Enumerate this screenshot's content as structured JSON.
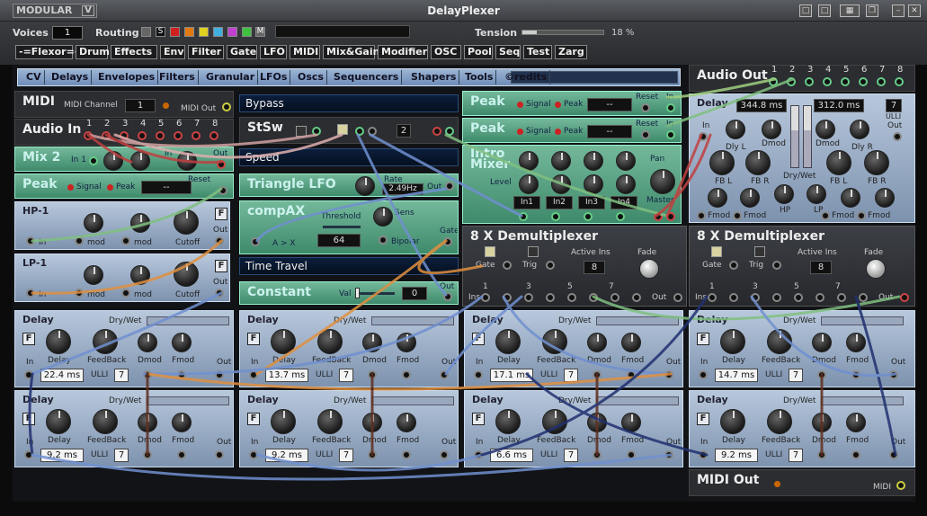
{
  "window": {
    "logo": "MODULAR",
    "logo_badge": "V",
    "title": "DelayPlexer",
    "buttons": [
      "□",
      "□",
      "▦",
      "❐",
      "–",
      "✕"
    ]
  },
  "topbar": {
    "voices_label": "Voices",
    "voices_value": "1",
    "routing_label": "Routing",
    "routing_s": "S",
    "routing_m": "M",
    "routing_colors": [
      "#d02020",
      "#e07a10",
      "#e0d020",
      "#40b0e0",
      "#c040d0",
      "#40c040"
    ],
    "tension_label": "Tension",
    "tension_value": "18 %",
    "tension_level": 0.18
  },
  "categories": [
    "-=Flexor=-",
    "Drum",
    "Effects",
    "Env",
    "Filter",
    "Gate",
    "LFO",
    "MIDI",
    "Mix&Gain",
    "Modifier",
    "OSC",
    "Pool",
    "Seq",
    "Test",
    "Zarg"
  ],
  "cv_tabs": [
    "CV",
    "Delays",
    "Envelopes",
    "Filters",
    "Granular",
    "LFOs",
    "Oscs",
    "Sequencers",
    "Shapers",
    "Tools",
    "©redits"
  ],
  "midi_module": {
    "title": "MIDI",
    "channel_label": "MIDI Channel",
    "channel": "1",
    "out_label": "MIDI Out"
  },
  "audio_in": {
    "title": "Audio In",
    "channels": [
      "1",
      "2",
      "3",
      "4",
      "5",
      "6",
      "7",
      "8"
    ]
  },
  "mix2": {
    "title": "Mix 2",
    "in1": "In 1",
    "in2": "In",
    "out": "Out"
  },
  "peak_left": {
    "title": "Peak",
    "signal": "Signal",
    "peak": "Peak",
    "value": "--",
    "reset": "Reset"
  },
  "hp1": {
    "title": "HP-1",
    "badge": "F",
    "in": "In",
    "mod1": "mod",
    "mod2": "mod",
    "cutoff": "Cutoff",
    "out": "Out"
  },
  "lp1": {
    "title": "LP-1",
    "badge": "F",
    "in": "In",
    "mod1": "mod",
    "mod2": "mod",
    "cutoff": "Cutoff",
    "out": "Out"
  },
  "bypass": {
    "label": "Bypass"
  },
  "stsw": {
    "title": "StSw",
    "value": "2"
  },
  "speed": {
    "label": "Speed"
  },
  "triangle_lfo": {
    "title": "Triangle LFO",
    "rate_label": "Rate",
    "rate": "2.49Hz",
    "out": "Out"
  },
  "compax": {
    "title": "compAX",
    "threshold_label": "Threshold",
    "threshold": "64",
    "sens": "Sens",
    "bipolar": "Bipolar",
    "gate": "Gate",
    "axb": "A > X"
  },
  "time_travel": {
    "label": "Time Travel"
  },
  "constant": {
    "title": "Constant",
    "val_label": "Val",
    "value": "0",
    "level": 0.0,
    "out": "Out"
  },
  "peak_a": {
    "title": "Peak",
    "signal": "Signal",
    "peak": "Peak",
    "value": "--",
    "reset": "Reset",
    "in": "In"
  },
  "peak_b": {
    "title": "Peak",
    "signal": "Signal",
    "peak": "Peak",
    "value": "--",
    "reset": "Reset",
    "in": "In"
  },
  "intro_mixer": {
    "title": "Intro Mixer",
    "level": "Level",
    "pan": "Pan",
    "inputs": [
      "In1",
      "In2",
      "In3",
      "In4"
    ],
    "master": "Master"
  },
  "audio_out": {
    "title": "Audio Out",
    "channels": [
      "1",
      "2",
      "3",
      "4",
      "5",
      "6",
      "7",
      "8"
    ]
  },
  "delay_big": {
    "title": "Delay",
    "time1": "344.8 ms",
    "time2": "312.0 ms",
    "ulli": "7",
    "ulli_label": "ULLI",
    "in": "In",
    "out": "Out",
    "dlyl": "Dly L",
    "dmod1": "Dmod",
    "dmod2": "Dmod",
    "dlyr": "Dly R",
    "drywet": "Dry/Wet",
    "fbl": "FB L",
    "fbr": "FB R",
    "fbl2": "FB L",
    "fbr2": "FB R",
    "fmod1": "Fmod",
    "fmod2": "Fmod",
    "fmod3": "Fmod",
    "fmod4": "Fmod",
    "hp": "HP",
    "lp": "LP"
  },
  "demux_a": {
    "title": "8 X Demultiplexer",
    "gate": "Gate",
    "trig": "Trig",
    "active_ins": "Active Ins",
    "active_value": "8",
    "fade": "Fade",
    "ins": "Ins",
    "out": "Out",
    "nums": [
      "1",
      "3",
      "5",
      "7"
    ]
  },
  "demux_b": {
    "title": "8 X Demultiplexer",
    "gate": "Gate",
    "trig": "Trig",
    "active_ins": "Active Ins",
    "active_value": "8",
    "fade": "Fade",
    "ins": "Ins",
    "out": "Out",
    "nums": [
      "1",
      "3",
      "5",
      "7"
    ]
  },
  "delay_labels": {
    "title": "Delay",
    "drywet": "Dry/Wet",
    "delay": "Delay",
    "feedback": "FeedBack",
    "dmod": "Dmod",
    "fmod": "Fmod",
    "in": "In",
    "out": "Out",
    "ulli": "ULLI",
    "badge": "F"
  },
  "delays_row1": [
    {
      "time": "22.4 ms",
      "ulli": "7"
    },
    {
      "time": "13.7 ms",
      "ulli": "7"
    },
    {
      "time": "17.1 ms",
      "ulli": "7"
    },
    {
      "time": "14.7 ms",
      "ulli": "7"
    }
  ],
  "delays_row2": [
    {
      "time": "9.2 ms",
      "ulli": "7"
    },
    {
      "time": "9.2 ms",
      "ulli": "7"
    },
    {
      "time": "6.6 ms",
      "ulli": "7"
    },
    {
      "time": "9.2 ms",
      "ulli": "7"
    }
  ],
  "midi_out": {
    "title": "MIDI Out",
    "label": "MIDI"
  }
}
